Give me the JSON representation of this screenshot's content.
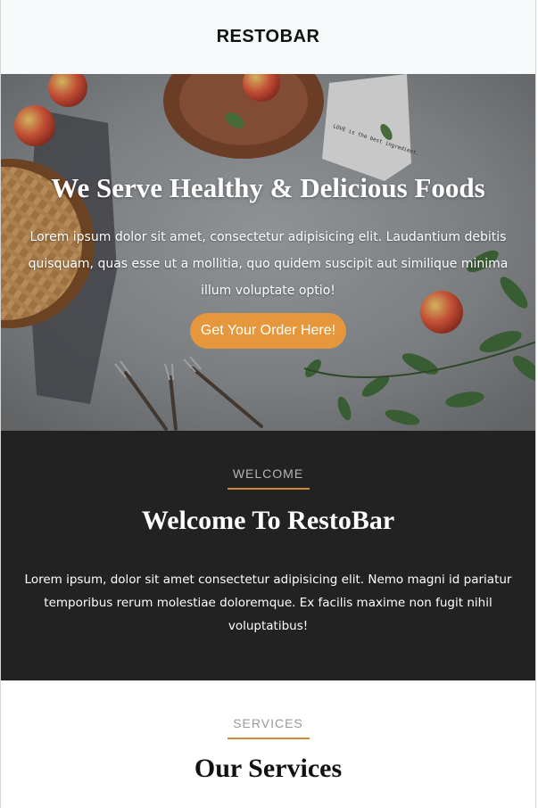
{
  "header": {
    "brand": "RESTOBAR"
  },
  "hero": {
    "title": "We Serve Healthy & Delicious Foods",
    "text": "Lorem ipsum dolor sit amet, consectetur adipisicing elit. Laudantium debitis quisquam, quas esse ut a mollitia, quo quidem suscipit aut similique minima illum voluptate optio!",
    "button_label": "Get Your Order Here!",
    "napkin_text": "LOVE is the best ingredient."
  },
  "welcome": {
    "eyebrow": "WELCOME",
    "title": "Welcome To RestoBar",
    "text": "Lorem ipsum, dolor sit amet consectetur adipisicing elit. Nemo magni id pariatur temporibus rerum molestiae doloremque. Ex facilis maxime non fugit nihil voluptatibus!"
  },
  "services": {
    "eyebrow": "SERVICES",
    "title": "Our Services"
  },
  "colors": {
    "accent": "#e6973b",
    "dark_section": "#222222",
    "header_bg": "#f6fafb"
  }
}
